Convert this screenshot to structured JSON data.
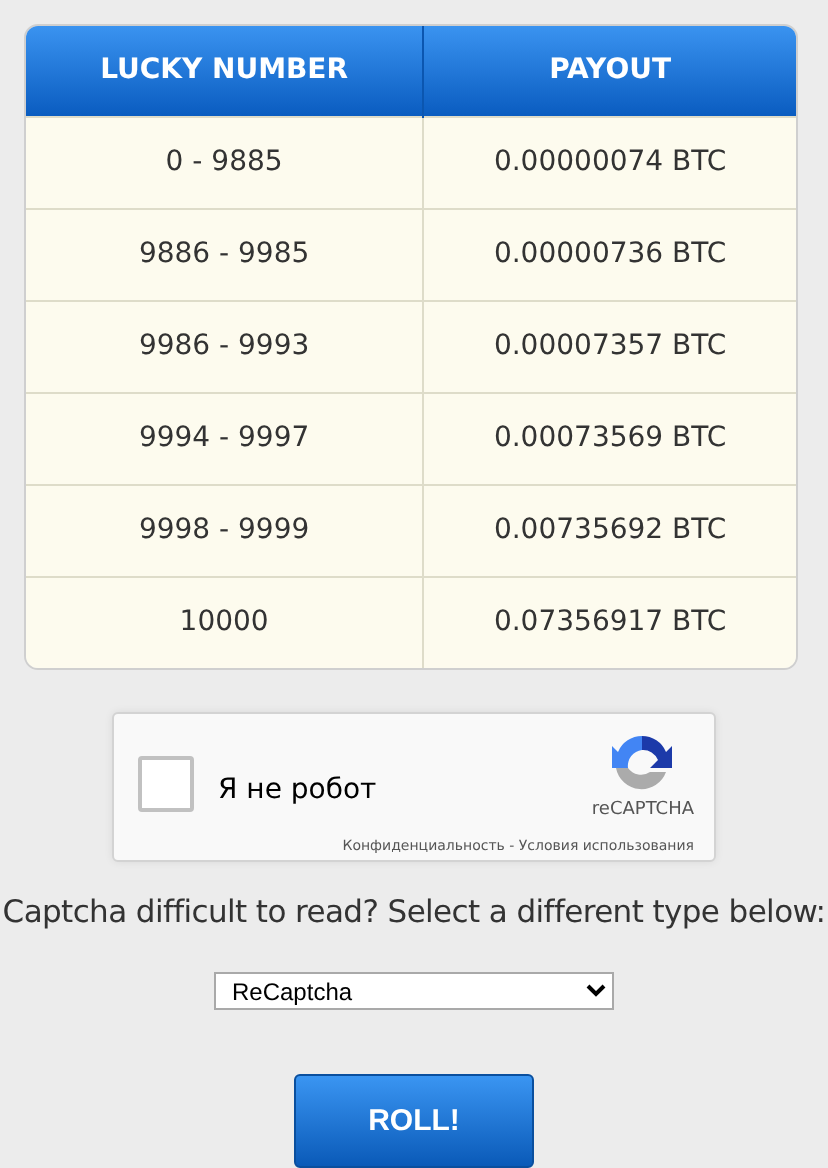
{
  "table": {
    "columns": [
      "LUCKY NUMBER",
      "PAYOUT"
    ],
    "rows": [
      [
        "0 - 9885",
        "0.00000074 BTC"
      ],
      [
        "9886 - 9985",
        "0.00000736 BTC"
      ],
      [
        "9986 - 9993",
        "0.00007357 BTC"
      ],
      [
        "9994 - 9997",
        "0.00073569 BTC"
      ],
      [
        "9998 - 9999",
        "0.00735692 BTC"
      ],
      [
        "10000",
        "0.07356917 BTC"
      ]
    ]
  },
  "captcha": {
    "checked": false,
    "label": "Я не робот",
    "brand": "reCAPTCHA",
    "links": [
      "Конфиденциальность",
      "Условия использования"
    ],
    "separator": " - "
  },
  "captcha_type": {
    "prompt": "Captcha difficult to read? Select a different type below:",
    "value": "ReCaptcha"
  },
  "roll_button": "ROLL!"
}
